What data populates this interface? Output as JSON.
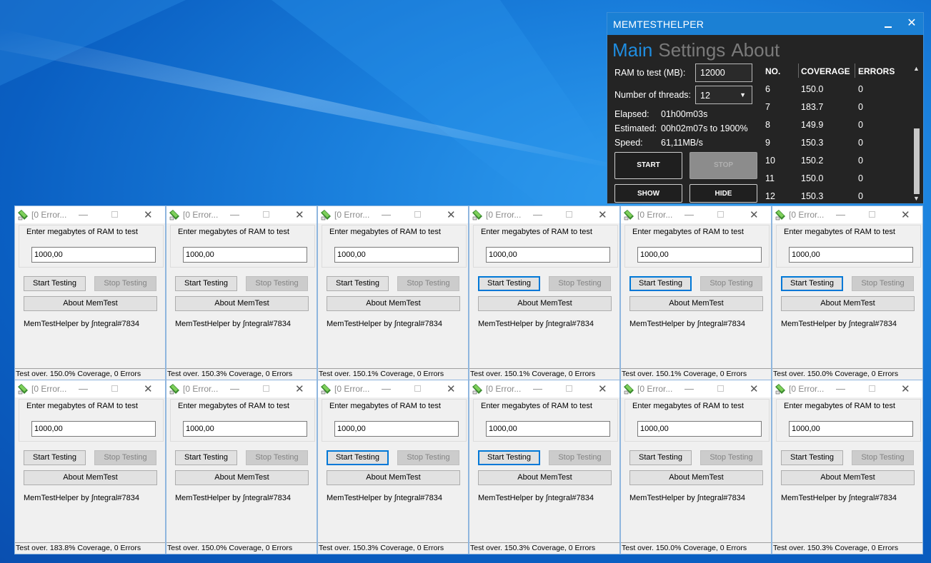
{
  "mth": {
    "title": "MEMTESTHELPER",
    "tabs": [
      {
        "label": "Main",
        "active": true
      },
      {
        "label": "Settings",
        "active": false
      },
      {
        "label": "About",
        "active": false
      }
    ],
    "ram_label": "RAM to test (MB):",
    "ram_value": "12000",
    "threads_label": "Number of threads:",
    "threads_value": "12",
    "elapsed_label": "Elapsed:",
    "elapsed_value": "01h00m03s",
    "estimated_label": "Estimated:",
    "estimated_value": "00h02m07s to 1900%",
    "speed_label": "Speed:",
    "speed_value": "61,11MB/s",
    "start_label": "START",
    "stop_label": "STOP",
    "show_label": "SHOW",
    "hide_label": "HIDE",
    "table": {
      "headers": [
        "NO.",
        "COVERAGE",
        "ERRORS"
      ],
      "rows": [
        {
          "no": "6",
          "coverage": "150.0",
          "errors": "0"
        },
        {
          "no": "7",
          "coverage": "183.7",
          "errors": "0"
        },
        {
          "no": "8",
          "coverage": "149.9",
          "errors": "0"
        },
        {
          "no": "9",
          "coverage": "150.3",
          "errors": "0"
        },
        {
          "no": "10",
          "coverage": "150.2",
          "errors": "0"
        },
        {
          "no": "11",
          "coverage": "150.0",
          "errors": "0"
        },
        {
          "no": "12",
          "coverage": "150.3",
          "errors": "0"
        }
      ]
    }
  },
  "memtest_common": {
    "title": "[0 Error...",
    "group_label": "Enter megabytes of RAM to test",
    "ram_value": "1000,00",
    "start_label": "Start Testing",
    "stop_label": "Stop Testing",
    "about_label": "About MemTest",
    "credit": "MemTestHelper by ∫ntegral#7834"
  },
  "memtest_windows": [
    {
      "status": "Test over. 150.0% Coverage, 0 Errors",
      "start_focused": false
    },
    {
      "status": "Test over. 150.3% Coverage, 0 Errors",
      "start_focused": false
    },
    {
      "status": "Test over. 150.1% Coverage, 0 Errors",
      "start_focused": false
    },
    {
      "status": "Test over. 150.1% Coverage, 0 Errors",
      "start_focused": true
    },
    {
      "status": "Test over. 150.1% Coverage, 0 Errors",
      "start_focused": true
    },
    {
      "status": "Test over. 150.0% Coverage, 0 Errors",
      "start_focused": true
    },
    {
      "status": "Test over. 183.8% Coverage, 0 Errors",
      "start_focused": false
    },
    {
      "status": "Test over. 150.0% Coverage, 0 Errors",
      "start_focused": false
    },
    {
      "status": "Test over. 150.3% Coverage, 0 Errors",
      "start_focused": true
    },
    {
      "status": "Test over. 150.3% Coverage, 0 Errors",
      "start_focused": true
    },
    {
      "status": "Test over. 150.0% Coverage, 0 Errors",
      "start_focused": false
    },
    {
      "status": "Test over. 150.3% Coverage, 0 Errors",
      "start_focused": false
    }
  ],
  "colors": {
    "accent": "#1b80d4",
    "dark_bg": "#242424",
    "focus_border": "#0078d7"
  }
}
